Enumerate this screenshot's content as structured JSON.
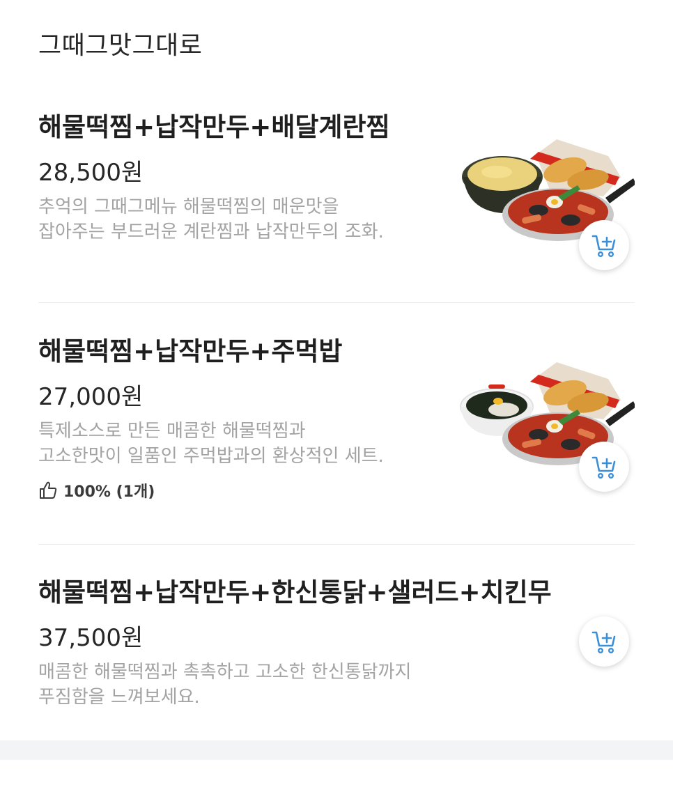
{
  "section": {
    "title": "그때그맛그대로"
  },
  "items": [
    {
      "name": "해물떡찜+납작만두+배달계란찜",
      "price": "28,500원",
      "desc": [
        "추억의 그때그메뉴 해물떡찜의 매운맛을",
        "잡아주는 부드러운 계란찜과 납작만두의 조화."
      ],
      "image": "seafood-tteokjjim-egg-dumpling-photo"
    },
    {
      "name": "해물떡찜+납작만두+주먹밥",
      "price": "27,000원",
      "desc": [
        "특제소스로 만든 매콤한 해물떡찜과",
        "고소한맛이 일품인 주먹밥과의 환상적인 세트."
      ],
      "rating": "100% (1개)",
      "image": "seafood-tteokjjim-riceball-dumpling-photo"
    },
    {
      "name": "해물떡찜+납작만두+한신통닭+샐러드+치킨무",
      "price": "37,500원",
      "desc": [
        "매콤한 해물떡찜과 촉촉하고 고소한 한신통닭까지",
        "푸짐함을 느껴보세요."
      ]
    }
  ],
  "icons": {
    "cart": "add-to-cart-icon",
    "thumb": "thumbs-up-icon"
  },
  "colors": {
    "accent": "#3b8fd9",
    "price": "#262626",
    "desc": "#a3a3a3",
    "divider": "#ececec",
    "footer": "#f3f4f6"
  }
}
